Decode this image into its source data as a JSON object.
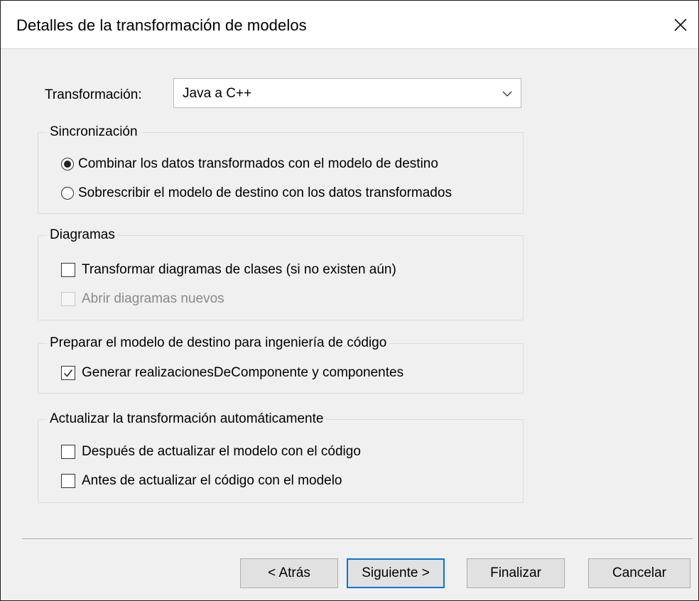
{
  "dialog": {
    "title": "Detalles de la transformación de modelos",
    "close_icon": "close-icon"
  },
  "transformation": {
    "label": "Transformación:",
    "selected": "Java a C++"
  },
  "sync": {
    "legend": "Sincronización",
    "options": [
      {
        "label": "Combinar los datos transformados con el modelo de destino",
        "checked": true
      },
      {
        "label": "Sobrescribir el modelo de destino con los datos transformados",
        "checked": false
      }
    ]
  },
  "diagrams": {
    "legend": "Diagramas",
    "options": [
      {
        "label": "Transformar diagramas de clases (si no existen aún)",
        "checked": false,
        "enabled": true
      },
      {
        "label": "Abrir diagramas nuevos",
        "checked": false,
        "enabled": false
      }
    ]
  },
  "code_eng": {
    "legend": "Preparar el modelo de destino para ingeniería de código",
    "options": [
      {
        "label": "Generar realizacionesDeComponente y componentes",
        "checked": true
      }
    ]
  },
  "auto_update": {
    "legend": "Actualizar la transformación automáticamente",
    "options": [
      {
        "label": "Después de actualizar el modelo con el código",
        "checked": false
      },
      {
        "label": "Antes de actualizar el código con el modelo",
        "checked": false
      }
    ]
  },
  "buttons": {
    "back": "< Atrás",
    "next": "Siguiente >",
    "finish": "Finalizar",
    "cancel": "Cancelar"
  },
  "colors": {
    "default_button_border": "#0078d7",
    "dialog_bg": "#f0f0f0"
  }
}
